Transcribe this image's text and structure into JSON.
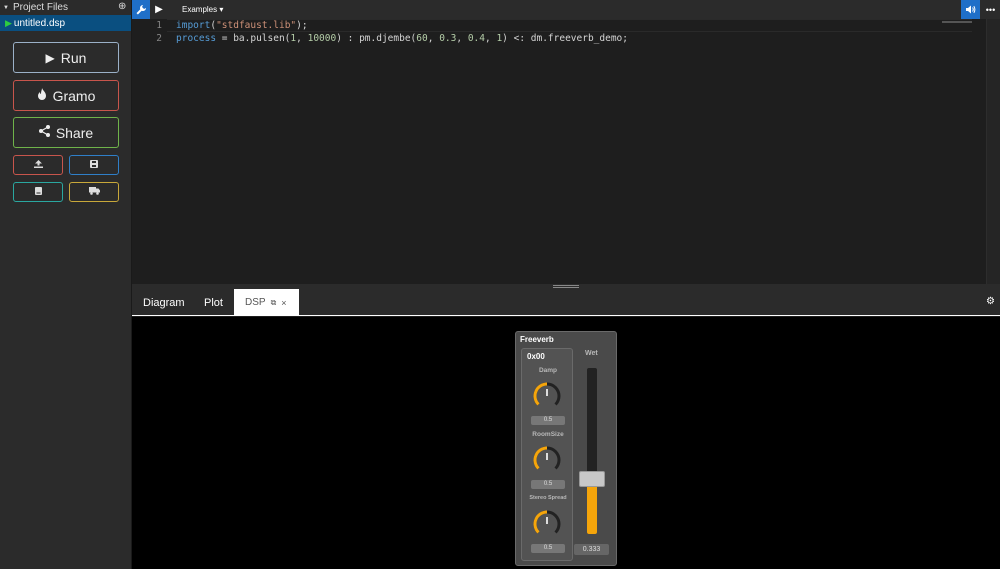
{
  "sidebar": {
    "header_label": "Project Files",
    "file_name": "untitled.dsp",
    "buttons": {
      "run": "Run",
      "gramo": "Gramo",
      "share": "Share"
    }
  },
  "toolbar": {
    "examples_label": "Examples ▾"
  },
  "editor": {
    "lines": [
      {
        "number": "1",
        "text": "import(\"stdfaust.lib\");"
      },
      {
        "number": "2",
        "text": "process = ba.pulsen(1, 10000) : pm.djembe(60, 0.3, 0.4, 1) <: dm.freeverb_demo;"
      }
    ]
  },
  "tabs": {
    "diagram": "Diagram",
    "plot": "Plot",
    "dsp": "DSP",
    "close": "×"
  },
  "dsp_ui": {
    "panel_title": "Freeverb",
    "group_title": "0x00",
    "knobs": [
      {
        "label": "Damp",
        "value": "0.5",
        "fraction": 0.5
      },
      {
        "label": "RoomSize",
        "value": "0.5",
        "fraction": 0.5
      },
      {
        "label": "Stereo Spread",
        "value": "0.5",
        "fraction": 0.5
      }
    ],
    "wet": {
      "label": "Wet",
      "value": "0.333",
      "fraction": 0.333
    },
    "accent_color": "#f5a50b"
  }
}
